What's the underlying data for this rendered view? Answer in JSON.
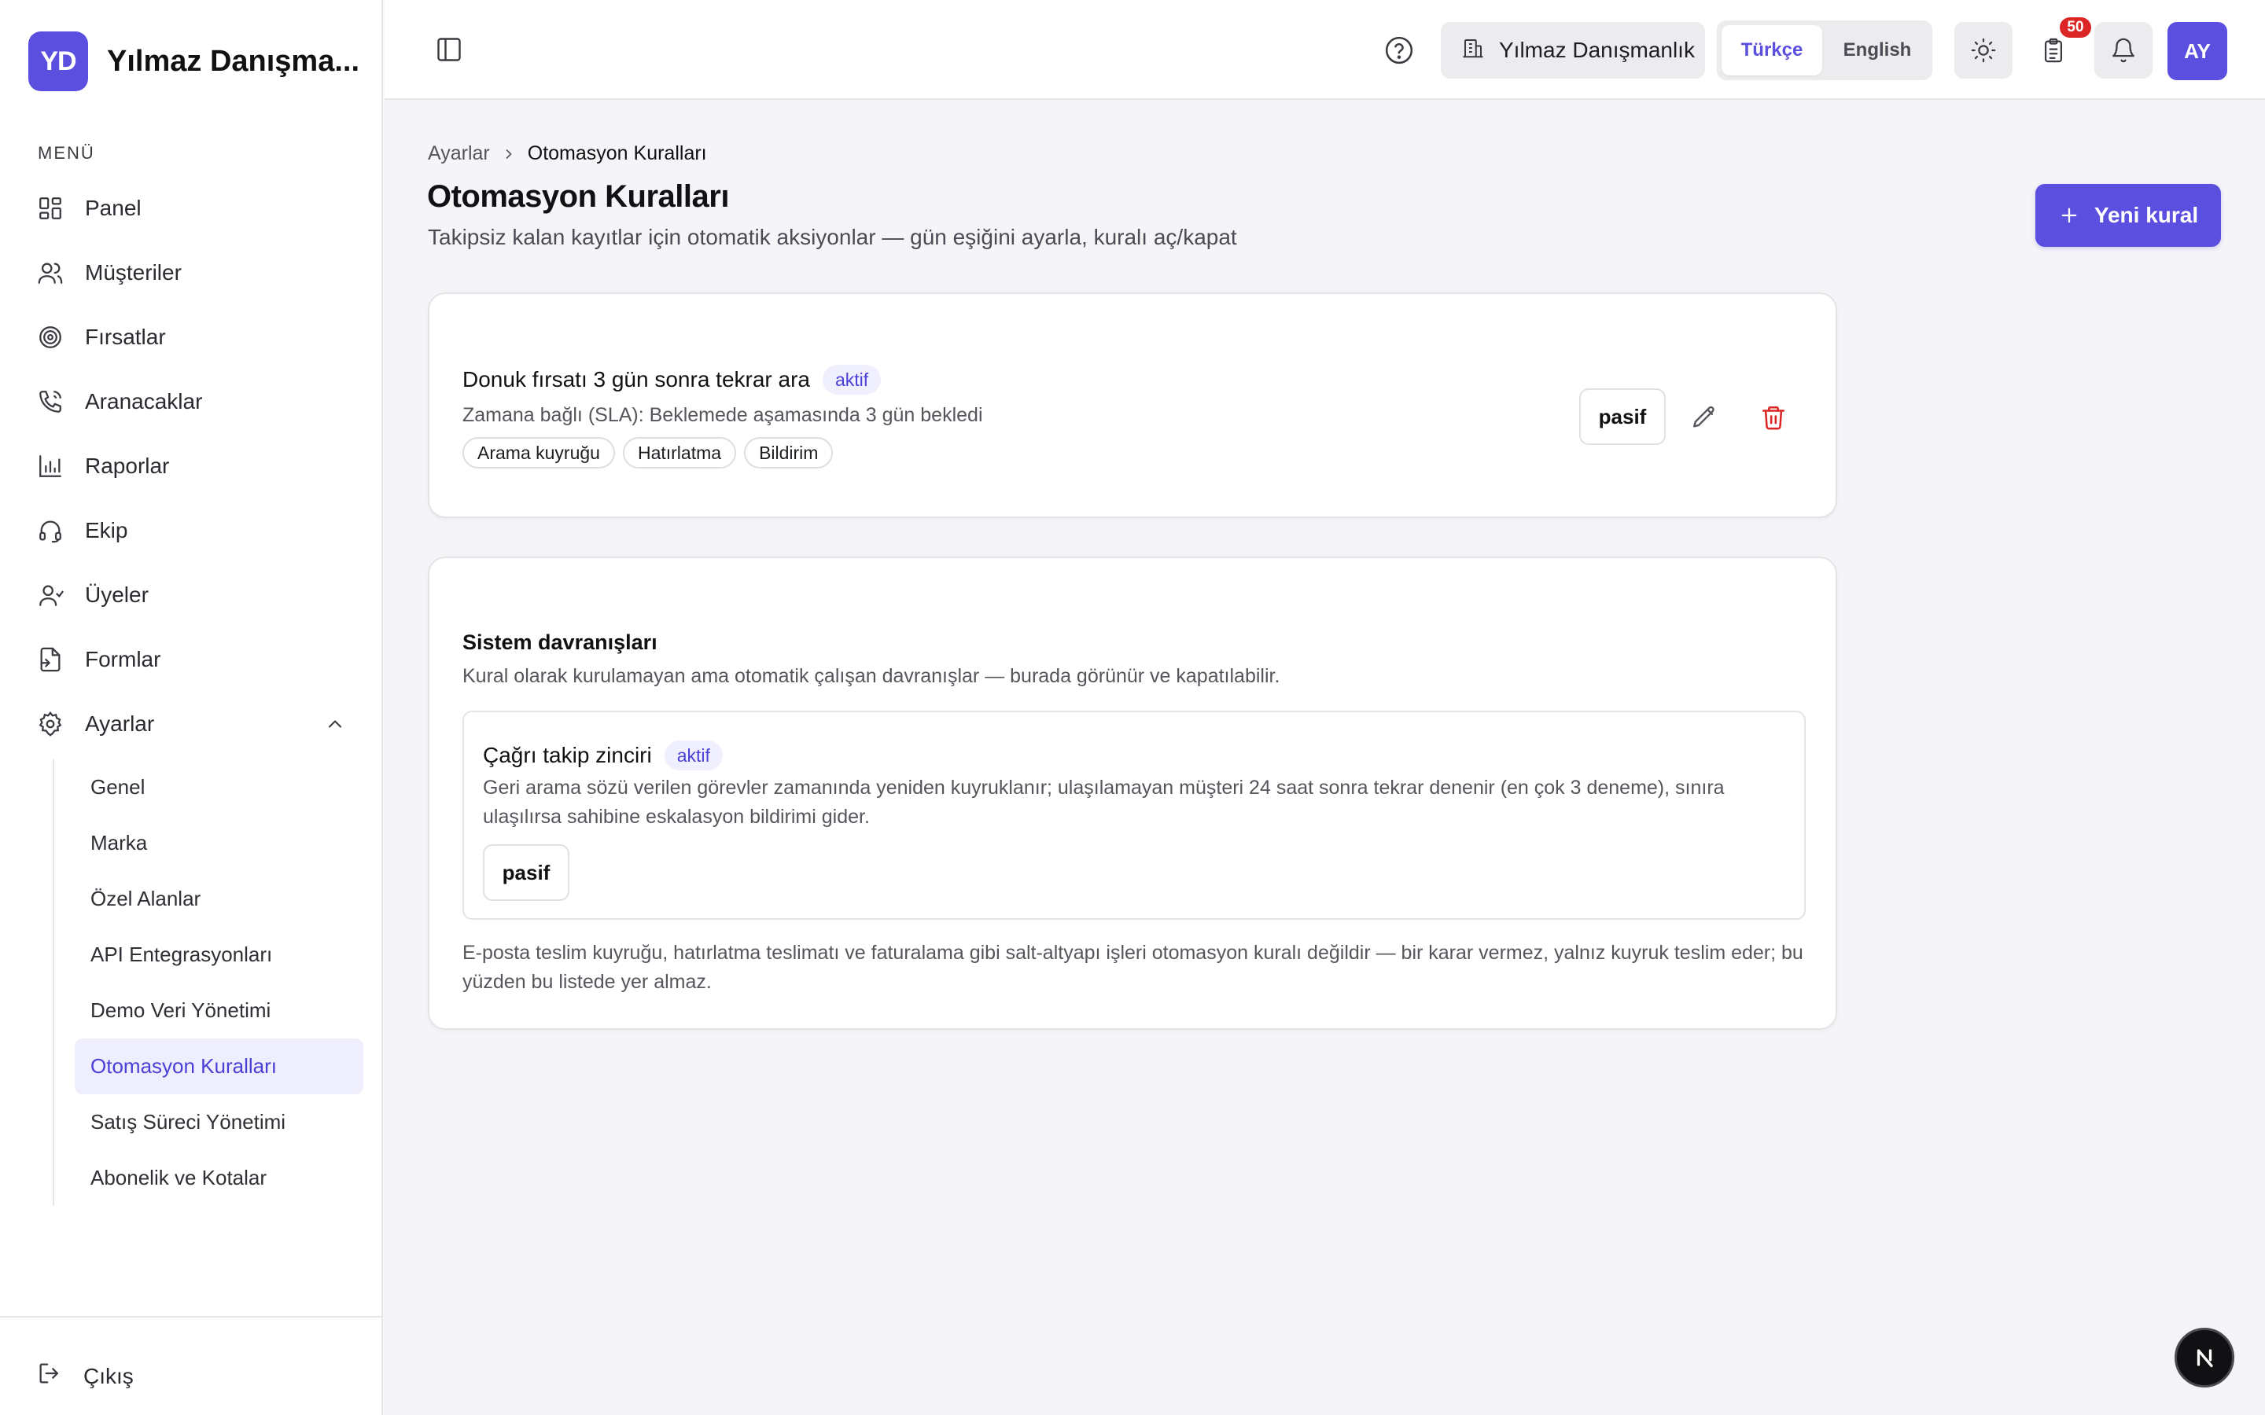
{
  "brand": {
    "initials": "YD",
    "name": "Yılmaz Danışma..."
  },
  "sidebar": {
    "menu_heading": "MENÜ",
    "items": [
      {
        "label": "Panel",
        "icon": "dashboard-icon"
      },
      {
        "label": "Müşteriler",
        "icon": "users-icon"
      },
      {
        "label": "Fırsatlar",
        "icon": "target-icon"
      },
      {
        "label": "Aranacaklar",
        "icon": "phone-icon"
      },
      {
        "label": "Raporlar",
        "icon": "bar-chart-icon"
      },
      {
        "label": "Ekip",
        "icon": "headset-icon"
      },
      {
        "label": "Üyeler",
        "icon": "user-group-icon"
      },
      {
        "label": "Formlar",
        "icon": "form-icon"
      },
      {
        "label": "Ayarlar",
        "icon": "gear-icon",
        "expanded": true
      }
    ],
    "settings_items": [
      {
        "label": "Genel"
      },
      {
        "label": "Marka"
      },
      {
        "label": "Özel Alanlar"
      },
      {
        "label": "API Entegrasyonları"
      },
      {
        "label": "Demo Veri Yönetimi"
      },
      {
        "label": "Otomasyon Kuralları",
        "active": true
      },
      {
        "label": "Satış Süreci Yönetimi"
      },
      {
        "label": "Abonelik ve Kotalar"
      }
    ],
    "logout_label": "Çıkış"
  },
  "header": {
    "org_name": "Yılmaz Danışmanlık",
    "languages": [
      {
        "label": "Türkçe",
        "active": true
      },
      {
        "label": "English",
        "active": false
      }
    ],
    "tasks_badge": "50",
    "avatar_initials": "AY"
  },
  "breadcrumb": {
    "parent": "Ayarlar",
    "current": "Otomasyon Kuralları"
  },
  "page": {
    "title": "Otomasyon Kuralları",
    "subtitle": "Takipsiz kalan kayıtlar için otomatik aksiyonlar — gün eşiğini ayarla, kuralı aç/kapat",
    "new_rule_label": "Yeni kural"
  },
  "rule": {
    "title": "Donuk fırsatı 3 gün sonra tekrar ara",
    "status": "aktif",
    "description": "Zamana bağlı (SLA): Beklemede aşamasında 3 gün bekledi",
    "tags": [
      "Arama kuyruğu",
      "Hatırlatma",
      "Bildirim"
    ],
    "toggle_label": "pasif"
  },
  "system": {
    "title": "Sistem davranışları",
    "description": "Kural olarak kurulamayan ama otomatik çalışan davranışlar — burada görünür ve kapatılabilir.",
    "behavior": {
      "title": "Çağrı takip zinciri",
      "status": "aktif",
      "description": "Geri arama sözü verilen görevler zamanında yeniden kuyruklanır; ulaşılamayan müşteri 24 saat sonra tekrar denenir (en çok 3 deneme), sınıra ulaşılırsa sahibine eskalasyon bildirimi gider.",
      "toggle_label": "pasif"
    },
    "footer": "E-posta teslim kuyruğu, hatırlatma teslimatı ve faturalama gibi salt-altyapı işleri otomasyon kuralı değildir — bir karar vermez, yalnız kuyruk teslim eder; bu yüzden bu listede yer almaz."
  },
  "colors": {
    "accent": "#5b4fe0",
    "danger": "#dc2626",
    "active_bg": "#efeefc",
    "page_bg": "#f5f5f7"
  }
}
